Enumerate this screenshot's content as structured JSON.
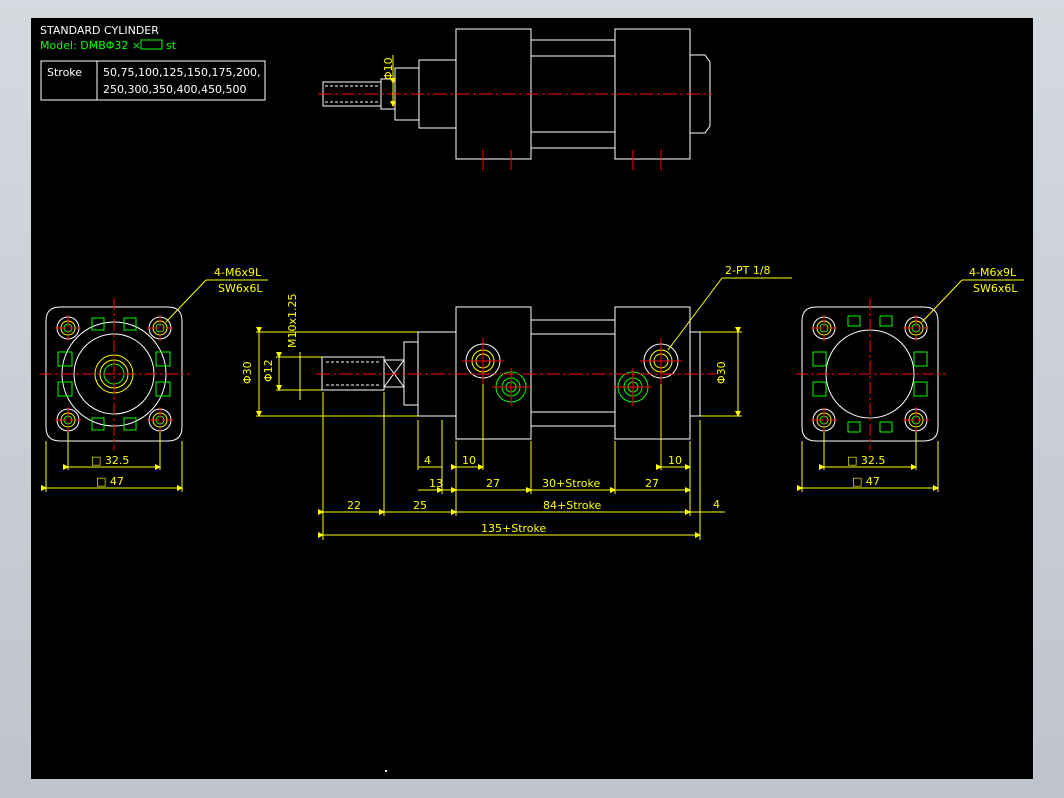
{
  "title_block": {
    "title": "STANDARD CYLINDER",
    "model_prefix": "Model: DMBΦ32 ×",
    "model_suffix": "st",
    "stroke_label": "Stroke",
    "stroke_values_line1": "50,75,100,125,150,175,200,",
    "stroke_values_line2": "250,300,350,400,450,500"
  },
  "labels": {
    "left_callout_top": "4-M6x9L",
    "left_callout_bottom": "SW6x6L",
    "right_callout_top": "4-M6x9L",
    "right_callout_bottom": "SW6x6L",
    "port_callout": "2-PT 1/8",
    "rod_dia_top": "Φ10",
    "thread_spec": "M10x1.25",
    "dia_30_left": "Φ30",
    "dia_12": "Φ12",
    "dia_30_right": "Φ30",
    "left_sq_inner": "□ 32.5",
    "left_sq_outer": "□ 47",
    "right_sq_inner": "□ 32.5",
    "right_sq_outer": "□ 47",
    "dim_4_left": "4",
    "dim_10_left": "10",
    "dim_10_right": "10",
    "dim_13": "13",
    "dim_27_left": "27",
    "dim_30_stroke": "30+Stroke",
    "dim_27_right": "27",
    "dim_22": "22",
    "dim_25": "25",
    "dim_84_stroke": "84+Stroke",
    "dim_4_right": "4",
    "dim_135_stroke": "135+Stroke"
  },
  "colors": {
    "background": "#000000",
    "outline": "#ffffff",
    "dimension": "#ffff00",
    "hidden": "#00ff00",
    "centerline": "#ff0000",
    "model_text": "#00ff00"
  }
}
